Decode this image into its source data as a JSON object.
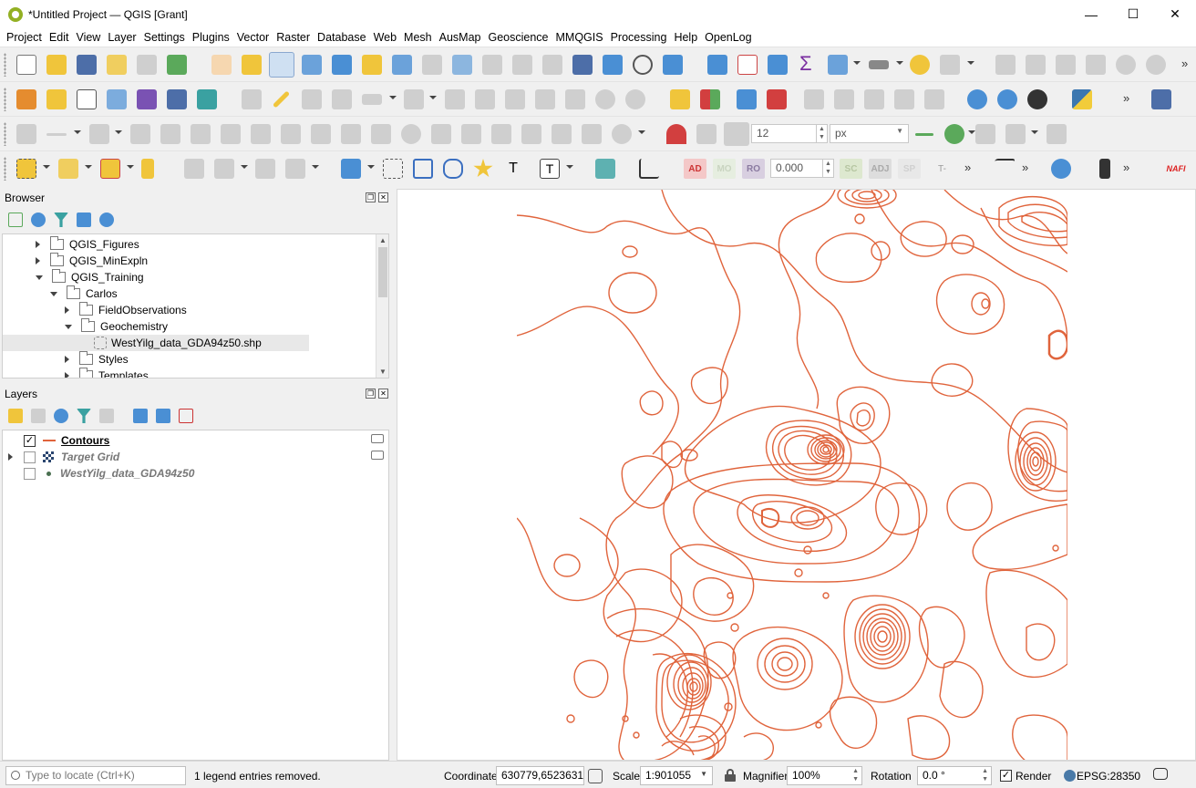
{
  "window": {
    "title": "*Untitled Project — QGIS [Grant]",
    "minimize": "—",
    "maximize": "☐",
    "close": "✕"
  },
  "menu": [
    "Project",
    "Edit",
    "View",
    "Layer",
    "Settings",
    "Plugins",
    "Vector",
    "Raster",
    "Database",
    "Web",
    "Mesh",
    "AusMap",
    "Geoscience",
    "MMQGIS",
    "Processing",
    "Help",
    "OpenLog"
  ],
  "toolbar3": {
    "size_value": "12",
    "unit": "px"
  },
  "toolbar4": {
    "ad": "AD",
    "mo": "MO",
    "ro": "RO",
    "offset": "0.000",
    "sc": "SC",
    "adj": "ADJ",
    "sp": "SP",
    "t_minus": "T-",
    "nafi": "NAFI"
  },
  "browser": {
    "title": "Browser",
    "items": [
      {
        "label": "QGIS_Figures"
      },
      {
        "label": "QGIS_MinExpln"
      },
      {
        "label": "QGIS_Training"
      },
      {
        "label": "Carlos"
      },
      {
        "label": "FieldObservations"
      },
      {
        "label": "Geochemistry"
      },
      {
        "label": "WestYilg_data_GDA94z50.shp"
      },
      {
        "label": "Styles"
      },
      {
        "label": "Templates"
      }
    ]
  },
  "layers": {
    "title": "Layers",
    "items": [
      {
        "label": "Contours",
        "checked": true
      },
      {
        "label": "Target Grid",
        "checked": false
      },
      {
        "label": "WestYilg_data_GDA94z50",
        "checked": false
      }
    ]
  },
  "colors": {
    "contour": "#e0643c",
    "accent": "#93b023"
  },
  "status": {
    "locate_placeholder": "Type to locate (Ctrl+K)",
    "message": "1 legend entries removed.",
    "coordinate_label": "Coordinate",
    "coordinate": "630779,6523631",
    "scale_label": "Scale",
    "scale": "1:901055",
    "magnifier_label": "Magnifier",
    "magnifier": "100%",
    "rotation_label": "Rotation",
    "rotation": "0.0 °",
    "render_label": "Render",
    "crs": "EPSG:28350"
  }
}
